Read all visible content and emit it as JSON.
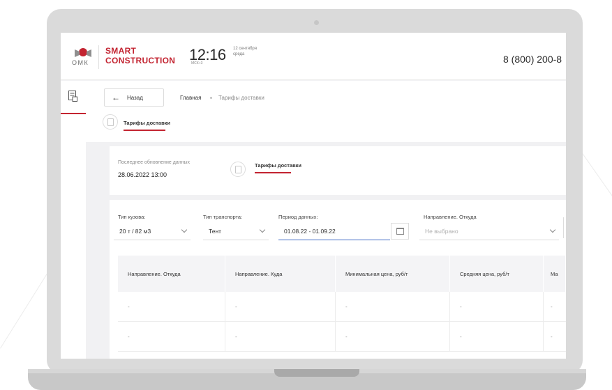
{
  "header": {
    "logo_text": "ОМК",
    "brand_line1": "SMART",
    "brand_line2": "CONSTRUCTION",
    "time": "12:16",
    "date_line1": "12 сентября",
    "date_line2": "среда",
    "timezone": "МСК+3",
    "phone": "8 (800) 200-8"
  },
  "breadcrumb": {
    "back_label": "Назад",
    "home": "Главная",
    "current": "Тарифы доставки"
  },
  "page_tab": {
    "label": "Тарифы доставки"
  },
  "update_card": {
    "label": "Последнее обновление данных",
    "value": "28.06.2022 13:00",
    "tab_label": "Тарифы доставки"
  },
  "filters": {
    "body_type": {
      "label": "Тип кузова:",
      "value": "20 т / 82 м3"
    },
    "transport_type": {
      "label": "Тип транспорта:",
      "value": "Тент"
    },
    "period": {
      "label": "Период данных:",
      "value": "01.08.22 - 01.09.22"
    },
    "direction_from": {
      "label": "Направление. Откуда",
      "placeholder": "Не выбрано"
    }
  },
  "table": {
    "headers": [
      "Направление. Откуда",
      "Направление. Куда",
      "Минимальная цена, руб/т",
      "Средняя цена, руб/т",
      "Ма"
    ],
    "rows": [
      [
        "-",
        "-",
        "-",
        "-",
        "-"
      ],
      [
        "-",
        "-",
        "-",
        "-",
        "-"
      ]
    ]
  },
  "colors": {
    "accent": "#c32431",
    "focus": "#3b66c4"
  }
}
